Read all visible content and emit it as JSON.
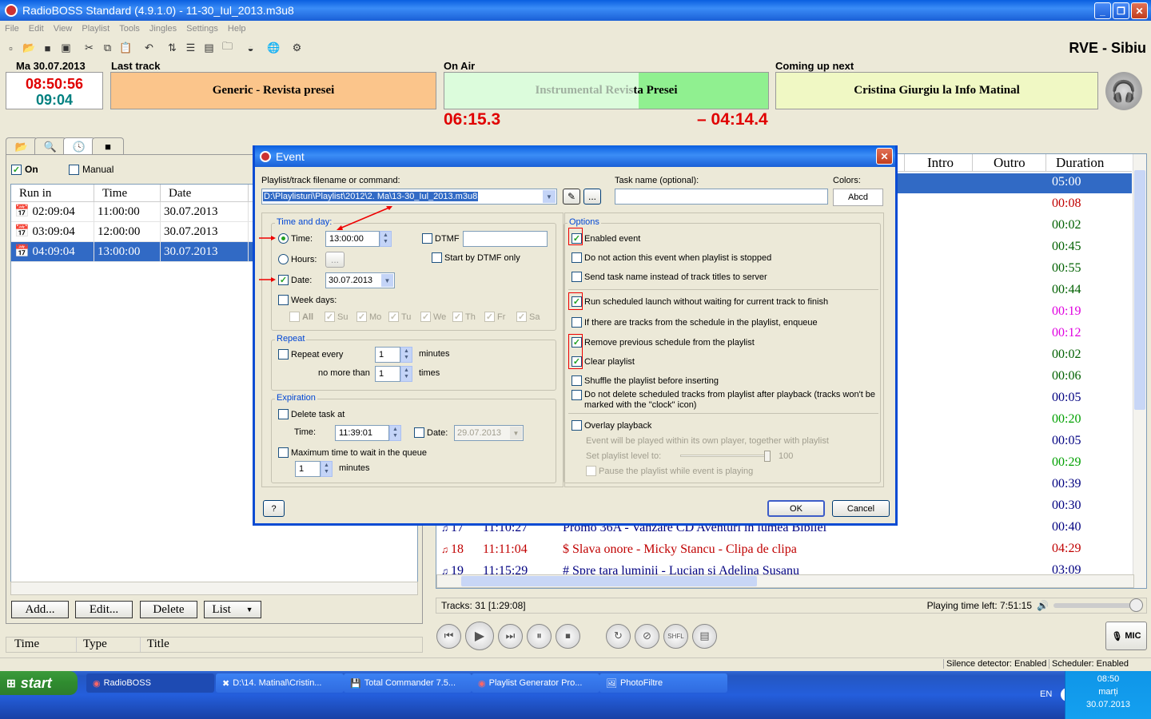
{
  "window": {
    "title": "RadioBOSS Standard (4.9.1.0) - 11-30_Iul_2013.m3u8"
  },
  "menu": [
    "File",
    "Edit",
    "View",
    "Playlist",
    "Tools",
    "Jingles",
    "Settings",
    "Help"
  ],
  "station": "RVE - Sibiu",
  "header": {
    "date": "Ma 30.07.2013",
    "clock_time": "08:50:56",
    "clock_remaining": "09:04",
    "last_track_label": "Last track",
    "last_track": "Generic - Revista presei",
    "on_air_label": "On Air",
    "on_air_title_fade": "Instrumental Revis",
    "on_air_title": "ta Presei",
    "on_air_elapsed": "06:15.3",
    "on_air_remaining": "– 04:14.4",
    "coming_label": "Coming up next",
    "coming_track": "Cristina Giurgiu la Info Matinal",
    "on_air_progress": 0.6
  },
  "scheduler": {
    "on_label": "On",
    "manual_label": "Manual",
    "columns": [
      "Run in",
      "Time",
      "Date"
    ],
    "rows": [
      {
        "run_in": "02:09:04",
        "time": "11:00:00",
        "date": "30.07.2013"
      },
      {
        "run_in": "03:09:04",
        "time": "12:00:00",
        "date": "30.07.2013"
      },
      {
        "run_in": "04:09:04",
        "time": "13:00:00",
        "date": "30.07.2013"
      }
    ],
    "buttons": {
      "add": "Add...",
      "edit": "Edit...",
      "delete": "Delete",
      "list": "List"
    },
    "bottom_cols": [
      "Time",
      "Type",
      "Title"
    ]
  },
  "playlist": {
    "columns": [
      "Intro",
      "Outro",
      "Duration"
    ],
    "durations": [
      {
        "v": "05:00",
        "c": "#ffffff"
      },
      {
        "v": "00:08",
        "c": "#c00000"
      },
      {
        "v": "00:02",
        "c": "#006000"
      },
      {
        "v": "00:45",
        "c": "#006000"
      },
      {
        "v": "00:55",
        "c": "#006000"
      },
      {
        "v": "00:44",
        "c": "#006000"
      },
      {
        "v": "00:19",
        "c": "#e000e0"
      },
      {
        "v": "00:12",
        "c": "#e000e0"
      },
      {
        "v": "00:02",
        "c": "#006000"
      },
      {
        "v": "00:06",
        "c": "#006000"
      },
      {
        "v": "00:05",
        "c": "#000080"
      },
      {
        "v": "00:20",
        "c": "#00a000"
      },
      {
        "v": "00:05",
        "c": "#000080"
      },
      {
        "v": "00:29",
        "c": "#00a000"
      },
      {
        "v": "00:39",
        "c": "#000080"
      },
      {
        "v": "00:30",
        "c": "#000080"
      },
      {
        "v": "00:40",
        "c": "#000080"
      },
      {
        "v": "04:29",
        "c": "#c00000"
      },
      {
        "v": "03:09",
        "c": "#000080"
      }
    ],
    "bottom_rows": [
      {
        "num": "17",
        "time": "11:10:27",
        "title": "Promo 36A - Vanzare CD Aventuri in lumea Bibliei",
        "c": "#000080"
      },
      {
        "num": "18",
        "time": "11:11:04",
        "title": "$ Slava onore - Micky Stancu - Clipa de clipa",
        "c": "#c00000"
      },
      {
        "num": "19",
        "time": "11:15:29",
        "title": "# Spre tara luminii - Lucian si Adelina Susanu",
        "c": "#000080"
      }
    ],
    "tracks": "Tracks: 31 [1:29:08]",
    "playing_left": "Playing time left: 7:51:15",
    "mic": "MIC"
  },
  "dialog": {
    "title": "Event",
    "filename_label": "Playlist/track filename or command:",
    "filename_value": "D:\\Playlisturi\\Playlist\\2012\\2. Ma\\13-30_Iul_2013.m3u8",
    "task_label": "Task name (optional):",
    "colors_label": "Colors:",
    "colors_sample": "Abcd",
    "time_day_label": "Time and day:",
    "time_label": "Time:",
    "time_value": "13:00:00",
    "dtmf_label": "DTMF",
    "start_dtmf_label": "Start by DTMF only",
    "hours_label": "Hours:",
    "hours_btn": "...",
    "date_label": "Date:",
    "date_value": "30.07.2013",
    "weekdays_label": "Week days:",
    "days": [
      "All",
      "Su",
      "Mo",
      "Tu",
      "We",
      "Th",
      "Fr",
      "Sa"
    ],
    "repeat_label": "Repeat",
    "repeat_every": "Repeat every",
    "repeat_value": "1",
    "minutes": "minutes",
    "no_more_than": "no more than",
    "times_value": "1",
    "times": "times",
    "expiration_label": "Expiration",
    "delete_task": "Delete task at",
    "exp_time_label": "Time:",
    "exp_time_value": "11:39:01",
    "exp_date_label": "Date:",
    "exp_date_value": "29.07.2013",
    "max_wait": "Maximum time to wait in the queue",
    "max_wait_value": "1",
    "options_label": "Options",
    "options": [
      {
        "label": "Enabled event",
        "checked": true
      },
      {
        "label": "Do not action this event when playlist is stopped",
        "checked": false
      },
      {
        "label": "Send task name instead of track titles to server",
        "checked": false
      },
      {
        "label": "Run scheduled launch without waiting for current track to finish",
        "checked": true
      },
      {
        "label": "If there are tracks from the schedule in the playlist, enqueue",
        "checked": false
      },
      {
        "label": "Remove previous schedule from the playlist",
        "checked": true
      },
      {
        "label": "Clear playlist",
        "checked": true
      },
      {
        "label": "Shuffle the playlist before inserting",
        "checked": false
      }
    ],
    "no_delete_1": "Do not delete scheduled tracks from playlist after playback (tracks won't be",
    "no_delete_2": "marked with the \"clock\" icon)",
    "overlay": "Overlay playback",
    "overlay_desc": "Event will be played within its own player, together with playlist",
    "set_level": "Set playlist level to:",
    "level_value": "100",
    "pause_playlist": "Pause the playlist while event is playing",
    "help_btn": "?",
    "ok": "OK",
    "cancel": "Cancel"
  },
  "status": {
    "silence": "Silence detector: Enabled",
    "scheduler": "Scheduler: Enabled"
  },
  "taskbar": {
    "start": "start",
    "tasks": [
      "RadioBOSS",
      "D:\\14. Matinal\\Cristin...",
      "Total Commander 7.5...",
      "Playlist Generator Pro...",
      "PhotoFiltre"
    ],
    "lang": "EN",
    "time": "08:50",
    "day": "marți",
    "date": "30.07.2013"
  }
}
